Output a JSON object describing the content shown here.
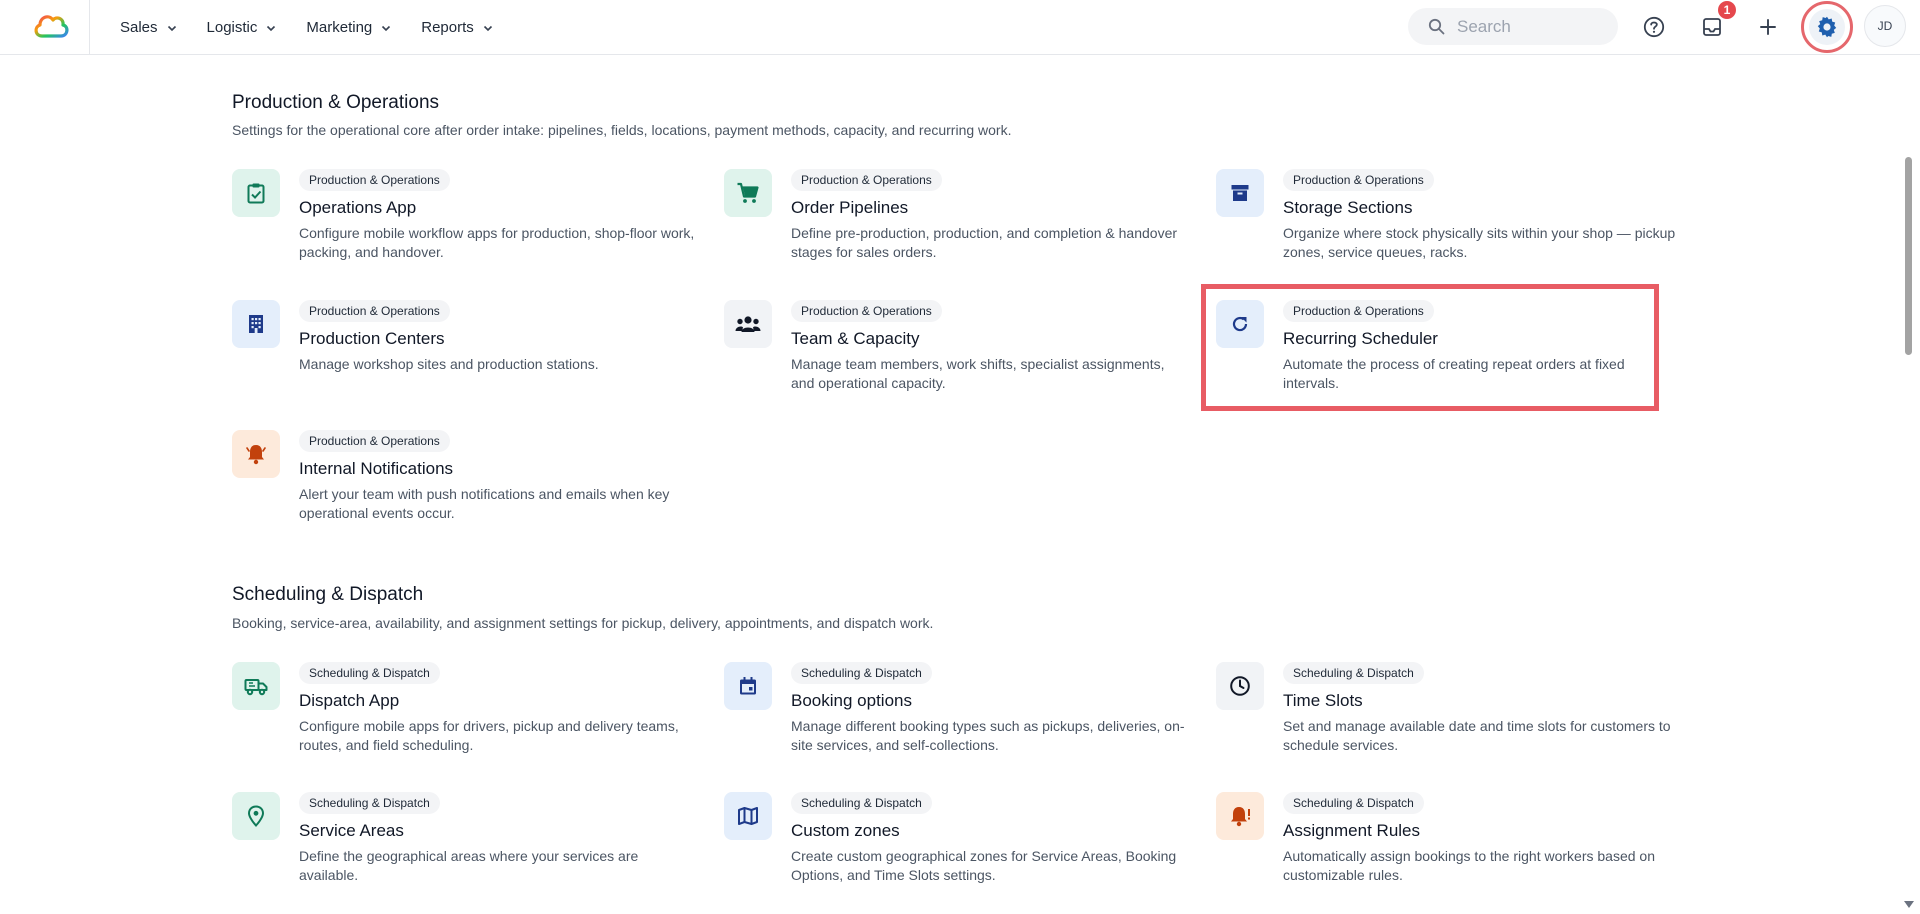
{
  "nav": {
    "items": [
      {
        "label": "Sales"
      },
      {
        "label": "Logistic"
      },
      {
        "label": "Marketing"
      },
      {
        "label": "Reports"
      }
    ]
  },
  "search": {
    "placeholder": "Search"
  },
  "inbox": {
    "badge": "1"
  },
  "avatar": {
    "initials": "JD"
  },
  "colors": {
    "accent": "#1f5fae",
    "highlight": "#e85c64",
    "badge": "#e5484d"
  },
  "sections": [
    {
      "title": "Production & Operations",
      "description": "Settings for the operational core after order intake: pipelines, fields, locations, payment methods, capacity, and recurring work.",
      "cards": [
        {
          "tag": "Production & Operations",
          "title": "Operations App",
          "description": "Configure mobile workflow apps for production, shop-floor work, packing, and handover.",
          "icon": "clipboard-check-icon"
        },
        {
          "tag": "Production & Operations",
          "title": "Order Pipelines",
          "description": "Define pre-production, production, and completion & handover stages for sales orders.",
          "icon": "cart-icon"
        },
        {
          "tag": "Production & Operations",
          "title": "Storage Sections",
          "description": "Organize where stock physically sits within your shop — pickup zones, service queues, racks.",
          "icon": "archive-box-icon"
        },
        {
          "tag": "Production & Operations",
          "title": "Production Centers",
          "description": "Manage workshop sites and production stations.",
          "icon": "building-icon"
        },
        {
          "tag": "Production & Operations",
          "title": "Team & Capacity",
          "description": "Manage team members, work shifts, specialist assignments, and operational capacity.",
          "icon": "team-icon"
        },
        {
          "tag": "Production & Operations",
          "title": "Recurring Scheduler",
          "description": "Automate the process of creating repeat orders at fixed intervals.",
          "icon": "refresh-icon"
        },
        {
          "tag": "Production & Operations",
          "title": "Internal Notifications",
          "description": "Alert your team with push notifications and emails when key operational events occur.",
          "icon": "bell-icon"
        }
      ]
    },
    {
      "title": "Scheduling & Dispatch",
      "description": "Booking, service-area, availability, and assignment settings for pickup, delivery, appointments, and dispatch work.",
      "cards": [
        {
          "tag": "Scheduling & Dispatch",
          "title": "Dispatch App",
          "description": "Configure mobile apps for drivers, pickup and delivery teams, routes, and field scheduling.",
          "icon": "truck-icon"
        },
        {
          "tag": "Scheduling & Dispatch",
          "title": "Booking options",
          "description": "Manage different booking types such as pickups, deliveries, on-site services, and self-collections.",
          "icon": "calendar-icon"
        },
        {
          "tag": "Scheduling & Dispatch",
          "title": "Time Slots",
          "description": "Set and manage available date and time slots for customers to schedule services.",
          "icon": "clock-icon"
        },
        {
          "tag": "Scheduling & Dispatch",
          "title": "Service Areas",
          "description": "Define the geographical areas where your services are available.",
          "icon": "location-pin-icon"
        },
        {
          "tag": "Scheduling & Dispatch",
          "title": "Custom zones",
          "description": "Create custom geographical zones for Service Areas, Booking Options, and Time Slots settings.",
          "icon": "map-icon"
        },
        {
          "tag": "Scheduling & Dispatch",
          "title": "Assignment Rules",
          "description": "Automatically assign bookings to the right workers based on customizable rules.",
          "icon": "bell-alert-icon"
        }
      ]
    }
  ]
}
